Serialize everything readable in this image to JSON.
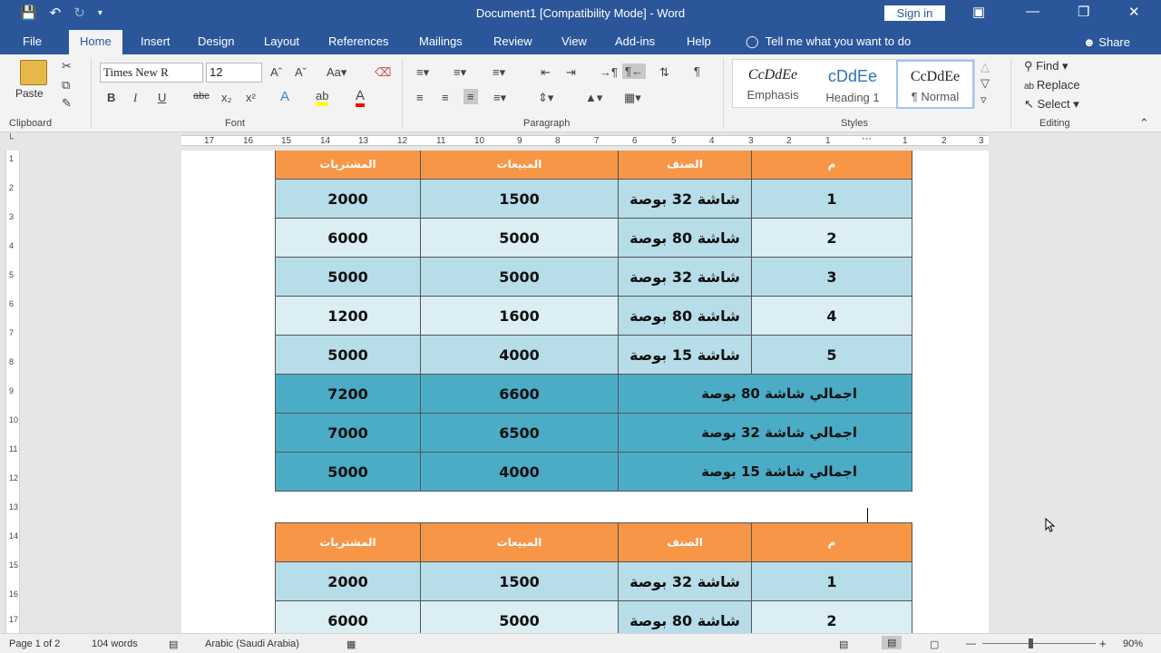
{
  "titlebar": {
    "document_title": "Document1 [Compatibility Mode]  -  Word",
    "sign_in": "Sign in"
  },
  "tabs": [
    "File",
    "Home",
    "Insert",
    "Design",
    "Layout",
    "References",
    "Mailings",
    "Review",
    "View",
    "Add-ins",
    "Help"
  ],
  "tell_me": "Tell me what you want to do",
  "share": "Share",
  "ribbon": {
    "clipboard": {
      "paste": "Paste",
      "label": "Clipboard"
    },
    "font": {
      "name": "Times New R",
      "size": "12",
      "label": "Font"
    },
    "paragraph": {
      "label": "Paragraph"
    },
    "styles": {
      "label": "Styles",
      "items": [
        {
          "preview": "CcDdEe",
          "name": "Emphasis"
        },
        {
          "preview": "cDdEe",
          "name": "Heading 1"
        },
        {
          "preview": "CcDdEe",
          "name": "¶ Normal"
        }
      ]
    },
    "editing": {
      "label": "Editing",
      "find": "Find",
      "replace": "Replace",
      "select": "Select"
    }
  },
  "ruler_numbers": [
    "17",
    "16",
    "15",
    "14",
    "13",
    "12",
    "11",
    "10",
    "9",
    "8",
    "7",
    "6",
    "5",
    "4",
    "3",
    "2",
    "1",
    "1",
    "2",
    "3"
  ],
  "vruler_numbers": [
    "1",
    "2",
    "3",
    "4",
    "5",
    "6",
    "7",
    "8",
    "9",
    "10",
    "11",
    "12",
    "13",
    "14",
    "15",
    "16",
    "17"
  ],
  "table1": {
    "headers": [
      "م",
      "الصنف",
      "المبيعات",
      "المشتريات"
    ],
    "rows": [
      [
        "1",
        "شاشة 32 بوصة",
        "1500",
        "2000"
      ],
      [
        "2",
        "شاشة 80 بوصة",
        "5000",
        "6000"
      ],
      [
        "3",
        "شاشة 32 بوصة",
        "5000",
        "5000"
      ],
      [
        "4",
        "شاشة 80 بوصة",
        "1600",
        "1200"
      ],
      [
        "5",
        "شاشة 15 بوصة",
        "4000",
        "5000"
      ]
    ],
    "totals": [
      [
        "اجمالي شاشة 80 بوصة",
        "6600",
        "7200"
      ],
      [
        "اجمالي شاشة 32 بوصة",
        "6500",
        "7000"
      ],
      [
        "اجمالي شاشة 15 بوصة",
        "4000",
        "5000"
      ]
    ]
  },
  "table2": {
    "headers": [
      "م",
      "الصنف",
      "المبيعات",
      "المشتريات"
    ],
    "rows": [
      [
        "1",
        "شاشة 32 بوصة",
        "1500",
        "2000"
      ],
      [
        "2",
        "شاشة 80 بوصة",
        "5000",
        "6000"
      ]
    ]
  },
  "status": {
    "page": "Page 1 of 2",
    "words": "104 words",
    "language": "Arabic (Saudi Arabia)",
    "zoom": "90%"
  }
}
